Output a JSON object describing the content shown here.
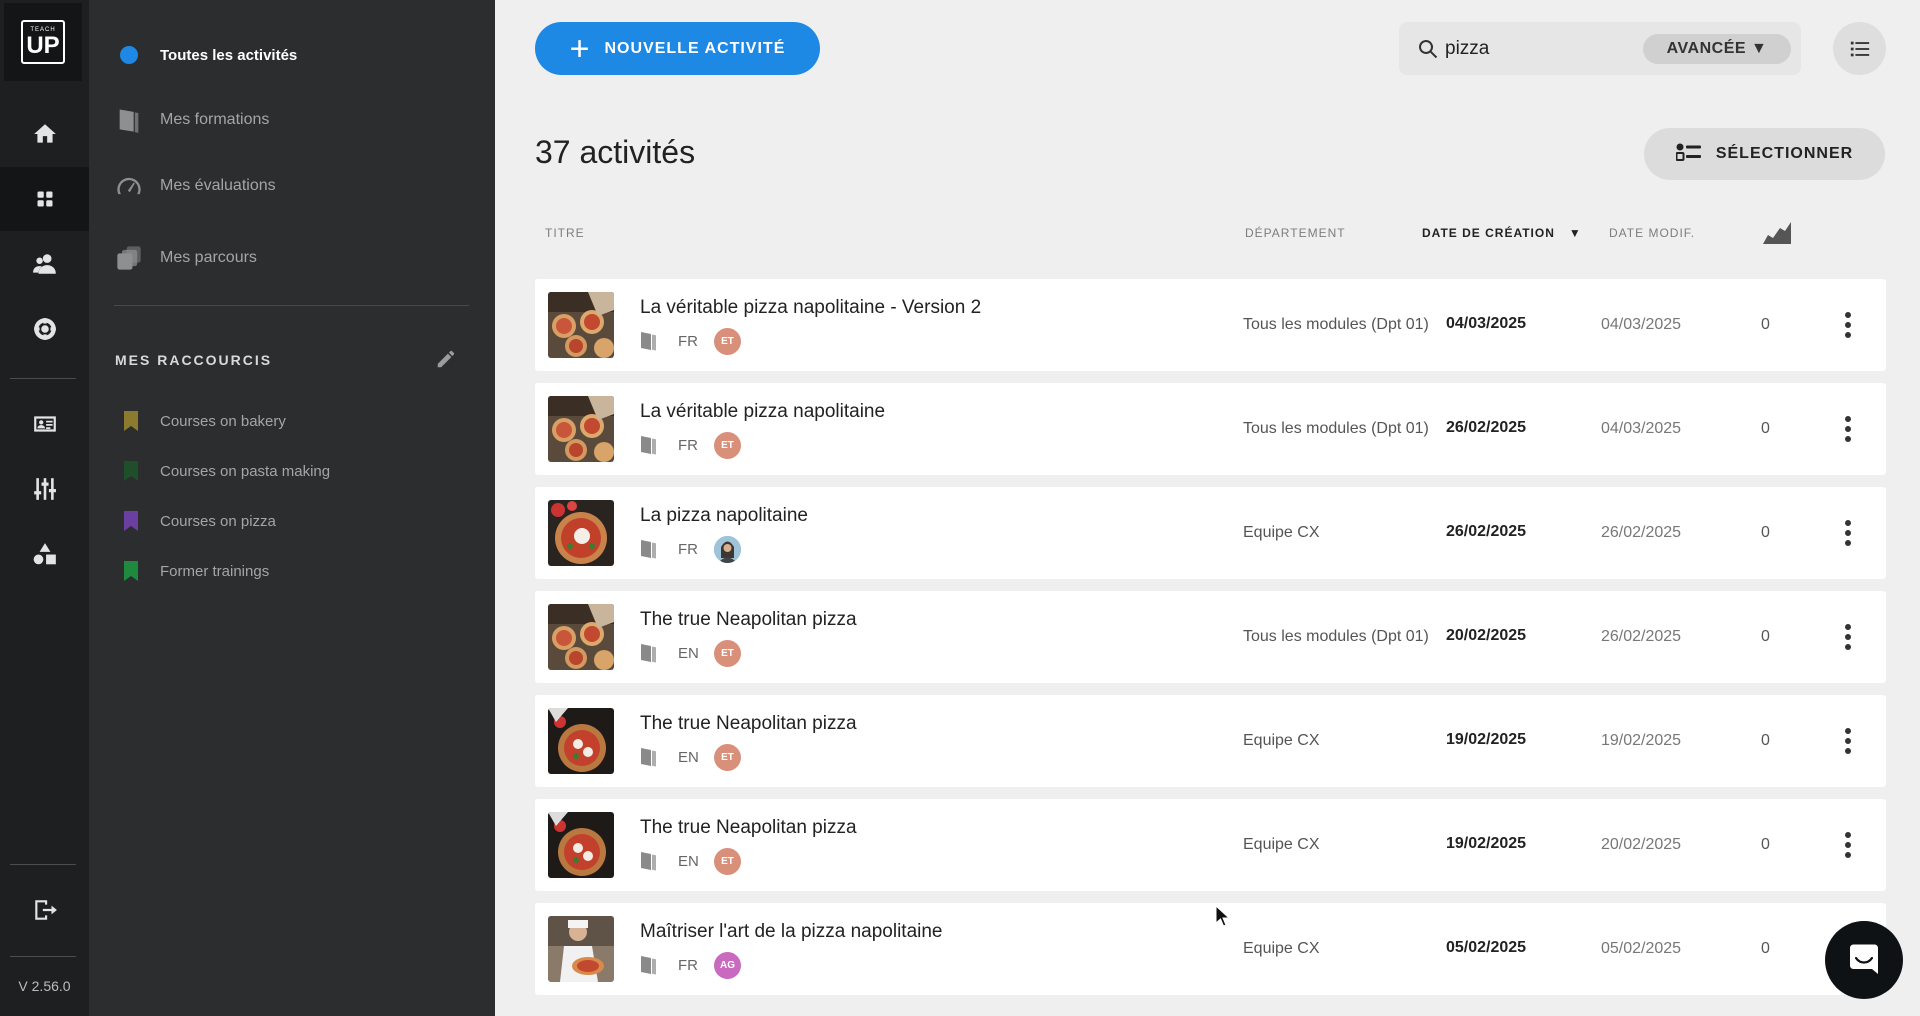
{
  "rail": {
    "logo_top": "TEACH",
    "logo_main": "UP",
    "version": "V 2.56.0",
    "icons": [
      "home-icon",
      "dashboard-icon",
      "users-icon",
      "support-icon",
      "id-card-icon",
      "settings-sliders-icon",
      "shapes-icon",
      "logout-icon"
    ]
  },
  "sidebar": {
    "nav": [
      {
        "label": "Toutes les activités",
        "active": true
      },
      {
        "label": "Mes formations",
        "active": false
      },
      {
        "label": "Mes évaluations",
        "active": false
      },
      {
        "label": "Mes parcours",
        "active": false
      }
    ],
    "shortcuts_title": "MES RACCOURCIS",
    "shortcuts": [
      {
        "label": "Courses on bakery",
        "color": "#8c7a2e"
      },
      {
        "label": "Courses on pasta making",
        "color": "#1f4f2a"
      },
      {
        "label": "Courses on pizza",
        "color": "#6a3fa0"
      },
      {
        "label": "Former trainings",
        "color": "#1f8a3e"
      }
    ]
  },
  "header": {
    "new_button": "NOUVELLE ACTIVITÉ",
    "search_value": "pizza",
    "advanced_button": "AVANCÉE ▼",
    "count_title": "37 activités",
    "select_button": "SÉLECTIONNER"
  },
  "columns": {
    "title": "TITRE",
    "department": "DÉPARTEMENT",
    "created": "DATE DE CRÉATION",
    "created_sort": "▼",
    "modified": "DATE MODIF."
  },
  "rows": [
    {
      "title": "La véritable pizza napolitaine - Version 2",
      "lang": "FR",
      "author": "ET",
      "author_color": "#d9907a",
      "dept": "Tous les modules (Dpt 01)",
      "created": "04/03/2025",
      "modified": "04/03/2025",
      "count": "0",
      "thumb": "pizza-tray"
    },
    {
      "title": "La véritable pizza napolitaine",
      "lang": "FR",
      "author": "ET",
      "author_color": "#d9907a",
      "dept": "Tous les modules (Dpt 01)",
      "created": "26/02/2025",
      "modified": "04/03/2025",
      "count": "0",
      "thumb": "pizza-tray"
    },
    {
      "title": "La pizza napolitaine",
      "lang": "FR",
      "author": "",
      "author_color": "#7aa9c8",
      "dept": "Equipe CX",
      "created": "26/02/2025",
      "modified": "26/02/2025",
      "count": "0",
      "thumb": "pizza-round"
    },
    {
      "title": "The true Neapolitan pizza",
      "lang": "EN",
      "author": "ET",
      "author_color": "#d9907a",
      "dept": "Tous les modules (Dpt 01)",
      "created": "20/02/2025",
      "modified": "26/02/2025",
      "count": "0",
      "thumb": "pizza-tray"
    },
    {
      "title": "The true Neapolitan pizza",
      "lang": "EN",
      "author": "ET",
      "author_color": "#d9907a",
      "dept": "Equipe CX",
      "created": "19/02/2025",
      "modified": "19/02/2025",
      "count": "0",
      "thumb": "pizza-dark"
    },
    {
      "title": "The true Neapolitan pizza",
      "lang": "EN",
      "author": "ET",
      "author_color": "#d9907a",
      "dept": "Equipe CX",
      "created": "19/02/2025",
      "modified": "20/02/2025",
      "count": "0",
      "thumb": "pizza-dark"
    },
    {
      "title": "Maîtriser l'art de la pizza napolitaine",
      "lang": "FR",
      "author": "AG",
      "author_color": "#c86bc0",
      "dept": "Equipe CX",
      "created": "05/02/2025",
      "modified": "05/02/2025",
      "count": "0",
      "thumb": "pizza-chef"
    }
  ]
}
